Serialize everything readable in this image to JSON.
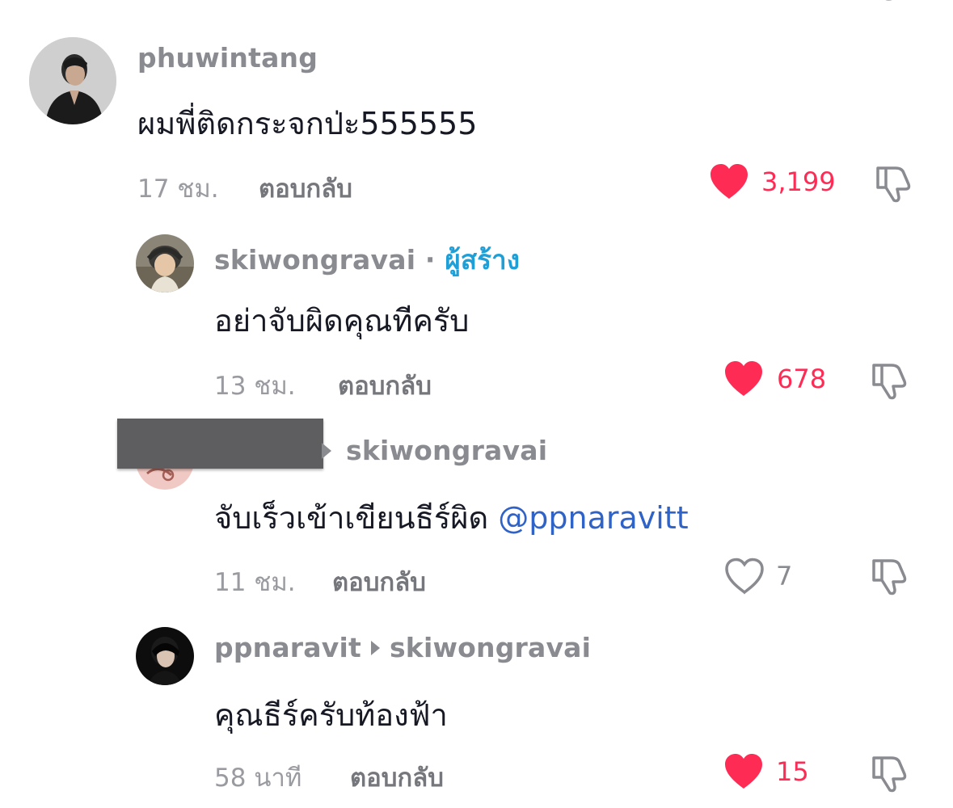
{
  "comments": [
    {
      "username": "phuwintang",
      "text": "ผมพี่ติดกระจกป่ะ555555",
      "time": "17 ชม.",
      "reply_label": "ตอบกลับ",
      "likes": "3,199",
      "liked": true
    },
    {
      "username": "skiwongravai",
      "separator": "·",
      "badge": "ผู้สร้าง",
      "text": "อย่าจับผิดคุณทีครับ",
      "time": "13 ชม.",
      "reply_label": "ตอบกลับ",
      "likes": "678",
      "liked": true
    },
    {
      "reply_to": "skiwongravai",
      "text": "จับเร็วเข้าเขียนธีร์ผิด ",
      "mention": "@ppnaravitt",
      "time": "11 ชม.",
      "reply_label": "ตอบกลับ",
      "likes": "7",
      "liked": false
    },
    {
      "username": "ppnaravit",
      "reply_to": "skiwongravai",
      "text": "คุณธีร์ครับท้องฟ้า",
      "time": "58 นาที",
      "reply_label": "ตอบกลับ",
      "likes": "15",
      "liked": true
    }
  ],
  "colors": {
    "like_active": "#fe2c55",
    "mention": "#2f63c7",
    "creator_badge": "#1f9fd6"
  },
  "icons": [
    "heart-filled-icon",
    "heart-outline-icon",
    "dislike-icon"
  ]
}
